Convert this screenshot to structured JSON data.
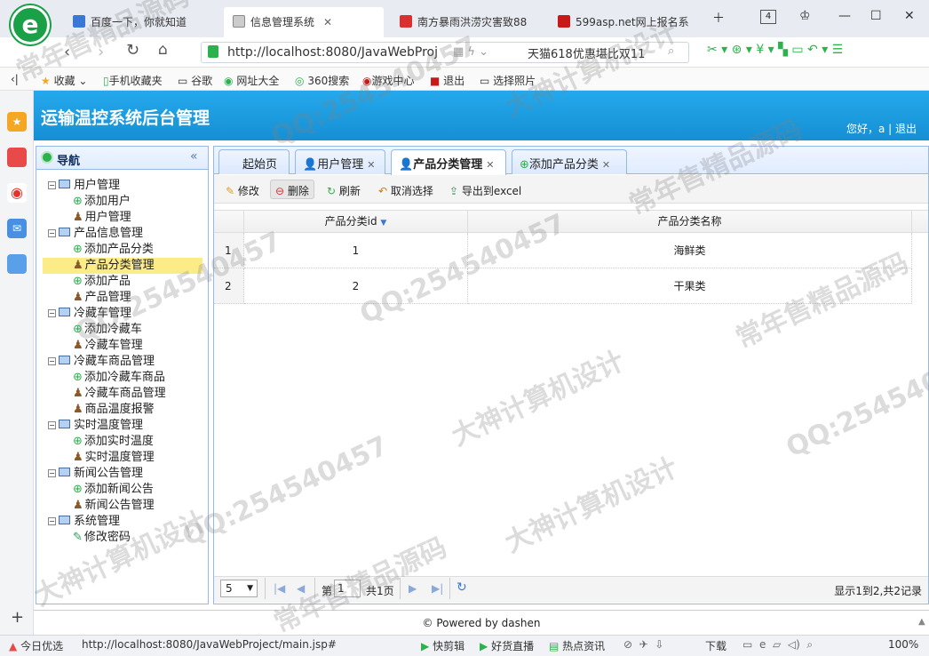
{
  "browser": {
    "tabs": [
      {
        "label": "百度一下，你就知道"
      },
      {
        "label": "信息管理系统"
      },
      {
        "label": "南方暴雨洪涝灾害致88"
      },
      {
        "label": "599asp.net网上报名系"
      }
    ],
    "tab_counter": "4",
    "url": "http://localhost:8080/JavaWebProj",
    "search_box": "天猫618优惠堪比双11",
    "bookmarks": [
      "收藏",
      "手机收藏夹",
      "谷歌",
      "网址大全",
      "360搜索",
      "游戏中心",
      "退出",
      "选择照片"
    ],
    "status_bar": {
      "left_label": "今日优选",
      "url": "http://localhost:8080/JavaWebProject/main.jsp#",
      "items": [
        "快剪辑",
        "好货直播",
        "热点资讯",
        "下载"
      ],
      "zoom": "100%"
    }
  },
  "header": {
    "title": "运输温控系统后台管理",
    "user_text": "您好，a | 退出"
  },
  "nav": {
    "title": "导航",
    "tree": [
      {
        "label": "用户管理",
        "children": [
          "添加用户",
          "用户管理"
        ]
      },
      {
        "label": "产品信息管理",
        "children": [
          "添加产品分类",
          "产品分类管理",
          "添加产品",
          "产品管理"
        ]
      },
      {
        "label": "冷藏车管理",
        "children": [
          "添加冷藏车",
          "冷藏车管理"
        ]
      },
      {
        "label": "冷藏车商品管理",
        "children": [
          "添加冷藏车商品",
          "冷藏车商品管理",
          "商品温度报警"
        ]
      },
      {
        "label": "实时温度管理",
        "children": [
          "添加实时温度",
          "实时温度管理"
        ]
      },
      {
        "label": "新闻公告管理",
        "children": [
          "添加新闻公告",
          "新闻公告管理"
        ]
      },
      {
        "label": "系统管理",
        "children": [
          "修改密码"
        ]
      }
    ]
  },
  "main": {
    "tabs": [
      "起始页",
      "用户管理",
      "产品分类管理",
      "添加产品分类"
    ],
    "toolbar": [
      "修改",
      "删除",
      "刷新",
      "取消选择",
      "导出到excel"
    ],
    "grid": {
      "columns": [
        "产品分类id",
        "产品分类名称"
      ],
      "rows": [
        {
          "index": "1",
          "id": "1",
          "name": "海鲜类"
        },
        {
          "index": "2",
          "id": "2",
          "name": "干果类"
        }
      ]
    },
    "pager": {
      "page_size": "5",
      "page_label": "第",
      "page_value": "1",
      "total_pages": "共1页",
      "summary": "显示1到2,共2记录"
    }
  },
  "footer": "© Powered by dashen",
  "watermarks": [
    "常年售精品源码",
    "QQ:254540457",
    "大神计算机设计"
  ]
}
